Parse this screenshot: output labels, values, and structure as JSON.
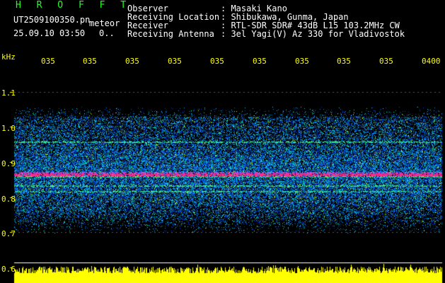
{
  "header": {
    "program": "H R O F F T",
    "filename": "UT2509100350.pn",
    "filetype": "meteor",
    "datetime": "25.09.10 03:50",
    "count": "0..",
    "fields": [
      {
        "label": "Observer",
        "value": ": Masaki Kano"
      },
      {
        "label": "Receiving Location",
        "value": ": Shibukawa, Gunma, Japan"
      },
      {
        "label": "Receiver",
        "value": ": RTL-SDR SDR# 43dB L15 103.2MHz CW"
      },
      {
        "label": "Receiving Antenna",
        "value": ": 3el Yagi(V) Az 330 for Vladivostok"
      }
    ]
  },
  "axes": {
    "y_unit": "kHz",
    "y_ticks": [
      "1.1",
      "1.0",
      "0.9",
      "0.8",
      "0.7",
      "0.6"
    ],
    "x_ticks": [
      "035",
      "035",
      "035",
      "035",
      "035",
      "035",
      "035",
      "035",
      "035",
      "0400"
    ]
  },
  "colors": {
    "background": "#000000",
    "axis_text": "#ffff00",
    "header_text": "#ffffff",
    "program_title": "#22ff22",
    "noise_floor": "#ffff00",
    "signal_line": "#ff2080"
  }
}
